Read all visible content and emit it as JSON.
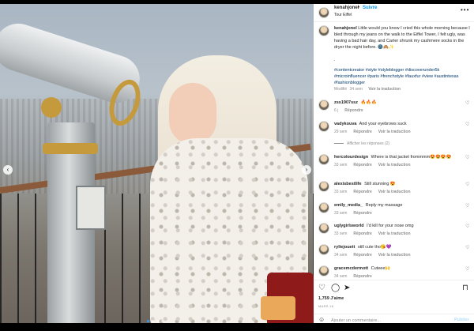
{
  "post": {
    "author": "kenahjonel",
    "follow_label": "Suivre",
    "separator": "•",
    "location": "Tour Eiffel",
    "more_icon": "more-horizontal-icon"
  },
  "caption": {
    "author": "kenahjonel",
    "text": "Little would you know I cried this whole morning because I bled through my jeans on the walk to the Eiffel Tower, I felt ugly, was having a bad hair day, and Carter shrunk my cashmere socks in the dryer the night before. 🌚🙈✨",
    "period": ".",
    "hashtags": "#contentcreator #style #styleblogger #discoverunder5k #microinfluencer #paris #frenchstyle #fauxfur #view #austintexas #fashionblogger",
    "edited_label": "Modifié",
    "time": "34 sem",
    "translate_label": "Voir la traduction"
  },
  "comments": [
    {
      "user": "zss1907ssz",
      "text": "🔥🔥🔥",
      "time": "6 j",
      "reply": "Répondre",
      "translate": ""
    },
    {
      "user": "vadykouva",
      "text": "And your eyebrows suck",
      "time": "29 sem",
      "reply": "Répondre",
      "translate": "Voir la traduction"
    },
    {
      "user": "hercolourdesign",
      "text": "Where is that jacket frommmm😍😍😍😍",
      "time": "33 sem",
      "reply": "Répondre",
      "translate": "Voir la traduction"
    },
    {
      "user": "alexisbestlife",
      "text": "Still stunning 😍",
      "time": "33 sem",
      "reply": "Répondre",
      "translate": "Voir la traduction"
    },
    {
      "user": "emily_media_",
      "text": "Reply my massage",
      "time": "33 sem",
      "reply": "Répondre",
      "translate": ""
    },
    {
      "user": "uglygirlsworld",
      "text": "I'd kill for your nose omg",
      "time": "33 sem",
      "reply": "Répondre",
      "translate": "Voir la traduction"
    },
    {
      "user": "ryliejouett",
      "text": "still cute tho😘💜",
      "time": "34 sem",
      "reply": "Répondre",
      "translate": "Voir la traduction"
    },
    {
      "user": "gracemcdermott",
      "text": "Cuteee🙌",
      "time": "34 sem",
      "reply": "Répondre",
      "translate": ""
    }
  ],
  "show_replies_label": "Afficher les réponses (2)",
  "likes": {
    "count": "1,759",
    "label": "J'aime"
  },
  "date_label": "MARS 16",
  "add_comment": {
    "placeholder": "Ajouter un commentaire...",
    "publish_label": "Publier"
  },
  "icons": {
    "like": "heart-icon",
    "comment": "comment-icon",
    "share": "share-icon",
    "save": "bookmark-icon",
    "emoji": "emoji-icon",
    "comment_like": "small-heart-icon"
  },
  "carousel": {
    "slides": 4,
    "active_index": 0
  }
}
